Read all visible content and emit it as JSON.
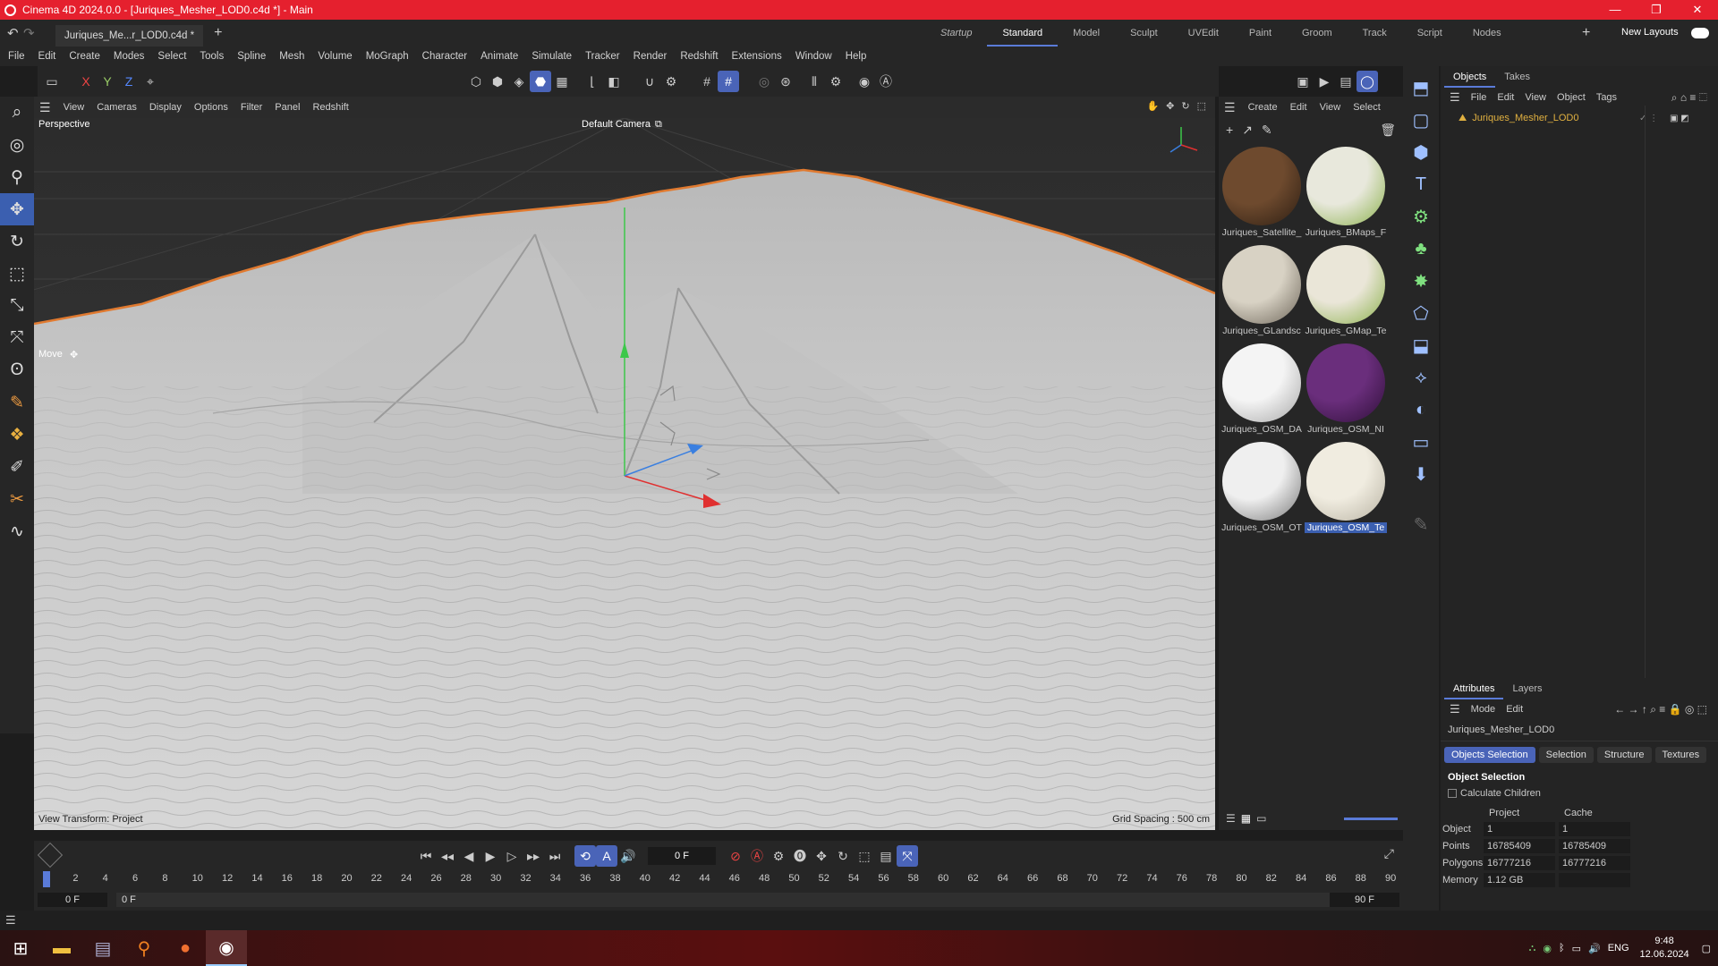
{
  "title_bar": {
    "title": "Cinema 4D 2024.0.0 - [Juriques_Mesher_LOD0.c4d *] - Main",
    "min": "—",
    "max": "❐",
    "close": "✕"
  },
  "doc_tab": {
    "label": "Juriques_Me...r_LOD0.c4d *",
    "add": "+"
  },
  "layouts": [
    "Startup",
    "Standard",
    "Model",
    "Sculpt",
    "UVEdit",
    "Paint",
    "Groom",
    "Track",
    "Script",
    "Nodes"
  ],
  "layouts_active": "Standard",
  "new_layouts": "New Layouts",
  "menu": [
    "File",
    "Edit",
    "Create",
    "Modes",
    "Select",
    "Tools",
    "Spline",
    "Mesh",
    "Volume",
    "MoGraph",
    "Character",
    "Animate",
    "Simulate",
    "Tracker",
    "Render",
    "Redshift",
    "Extensions",
    "Window",
    "Help"
  ],
  "axis_buttons": [
    "X",
    "Y",
    "Z"
  ],
  "viewport_menu": [
    "View",
    "Cameras",
    "Display",
    "Options",
    "Filter",
    "Panel",
    "Redshift"
  ],
  "viewport": {
    "label": "Perspective",
    "camera": "Default Camera",
    "camera_icon": "⧉",
    "move_label": "Move",
    "move_icon": "✥",
    "view_transform": "View Transform: Project",
    "grid_spacing": "Grid Spacing : 500 cm"
  },
  "material_menu": [
    "Create",
    "Edit",
    "View",
    "Select"
  ],
  "materials": [
    {
      "name": "Juriques_Satellite_",
      "color_a": "#6e4a2e",
      "color_b": "#2b1d12"
    },
    {
      "name": "Juriques_BMaps_F",
      "color_a": "#e8e8dc",
      "color_b": "#8ab04a"
    },
    {
      "name": "Juriques_GLandsc",
      "color_a": "#d8d2c4",
      "color_b": "#6c6458"
    },
    {
      "name": "Juriques_GMap_Te",
      "color_a": "#eae6d8",
      "color_b": "#8ab04a"
    },
    {
      "name": "Juriques_OSM_DA",
      "color_a": "#f4f4f4",
      "color_b": "#a6a6a6"
    },
    {
      "name": "Juriques_OSM_NI",
      "color_a": "#6a2e7c",
      "color_b": "#2e0f38"
    },
    {
      "name": "Juriques_OSM_OT",
      "color_a": "#efefef",
      "color_b": "#777777"
    },
    {
      "name": "Juriques_OSM_Te",
      "color_a": "#f0ece0",
      "color_b": "#b8b2a2"
    }
  ],
  "objects_panel": {
    "tabs": [
      "Objects",
      "Takes"
    ],
    "menu": [
      "File",
      "Edit",
      "View",
      "Object",
      "Tags"
    ],
    "item": "Juriques_Mesher_LOD0"
  },
  "attributes_panel": {
    "tabs": [
      "Attributes",
      "Layers"
    ],
    "menu": [
      "Mode",
      "Edit"
    ],
    "object_name": "Juriques_Mesher_LOD0",
    "buttons": [
      "Objects Selection",
      "Selection",
      "Structure",
      "Textures"
    ],
    "section": "Object Selection",
    "checkbox": "Calculate Children",
    "columns": [
      "Project",
      "Cache"
    ],
    "rows": [
      {
        "label": "Object",
        "project": "1",
        "cache": "1"
      },
      {
        "label": "Points",
        "project": "16785409",
        "cache": "16785409"
      },
      {
        "label": "Polygons",
        "project": "16777216",
        "cache": "16777216"
      },
      {
        "label": "Memory",
        "project": "1.12 GB",
        "cache": ""
      }
    ]
  },
  "timeline": {
    "current_frame": "0 F",
    "ruler": [
      "0",
      "2",
      "4",
      "6",
      "8",
      "10",
      "12",
      "14",
      "16",
      "18",
      "20",
      "22",
      "24",
      "26",
      "28",
      "30",
      "32",
      "34",
      "36",
      "38",
      "40",
      "42",
      "44",
      "46",
      "48",
      "50",
      "52",
      "54",
      "56",
      "58",
      "60",
      "62",
      "64",
      "66",
      "68",
      "70",
      "72",
      "74",
      "76",
      "78",
      "80",
      "82",
      "84",
      "86",
      "88",
      "90"
    ],
    "start_a": "0 F",
    "start_b": "0 F",
    "end_a": "90 F",
    "end_b": "90 F"
  },
  "taskbar": {
    "lang": "ENG",
    "time": "9:48",
    "date": "12.06.2024"
  },
  "colors": {
    "title_red": "#e5202e",
    "accent_blue": "#4a64b8",
    "selection_orange": "#e07a30"
  }
}
